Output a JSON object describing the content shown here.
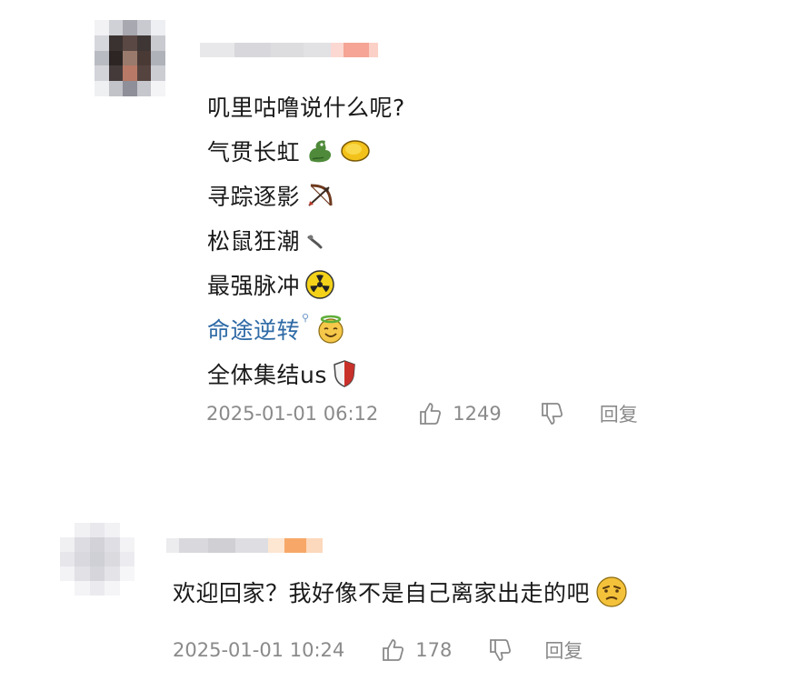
{
  "comments": [
    {
      "lines": [
        {
          "text": "叽里咕噜说什么呢?",
          "icons": []
        },
        {
          "text": "气贯长虹",
          "icons": [
            "dragon-icon",
            "gold-coin-icon"
          ]
        },
        {
          "text": "寻踪逐影",
          "icons": [
            "bow-arrow-icon"
          ]
        },
        {
          "text": "松鼠狂潮",
          "icons": [
            "squirrel-icon"
          ]
        },
        {
          "text": "最强脉冲",
          "icons": [
            "radioactive-icon"
          ]
        },
        {
          "text": "命途逆转",
          "icons": [
            "halo-smile-icon"
          ],
          "link": true
        },
        {
          "text": "全体集结us",
          "icons": [
            "shield-icon"
          ]
        }
      ],
      "time": "2025-01-01 06:12",
      "likes": "1249",
      "reply_label": "回复"
    },
    {
      "text": "欢迎回家？我好像不是自己离家出走的吧",
      "icon": "thinking-face-icon",
      "time": "2025-01-01 10:24",
      "likes": "178",
      "reply_label": "回复"
    }
  ],
  "colors": {
    "link": "#2e6aa6",
    "meta": "#8a8a8a",
    "badge": "#f28a6e"
  }
}
